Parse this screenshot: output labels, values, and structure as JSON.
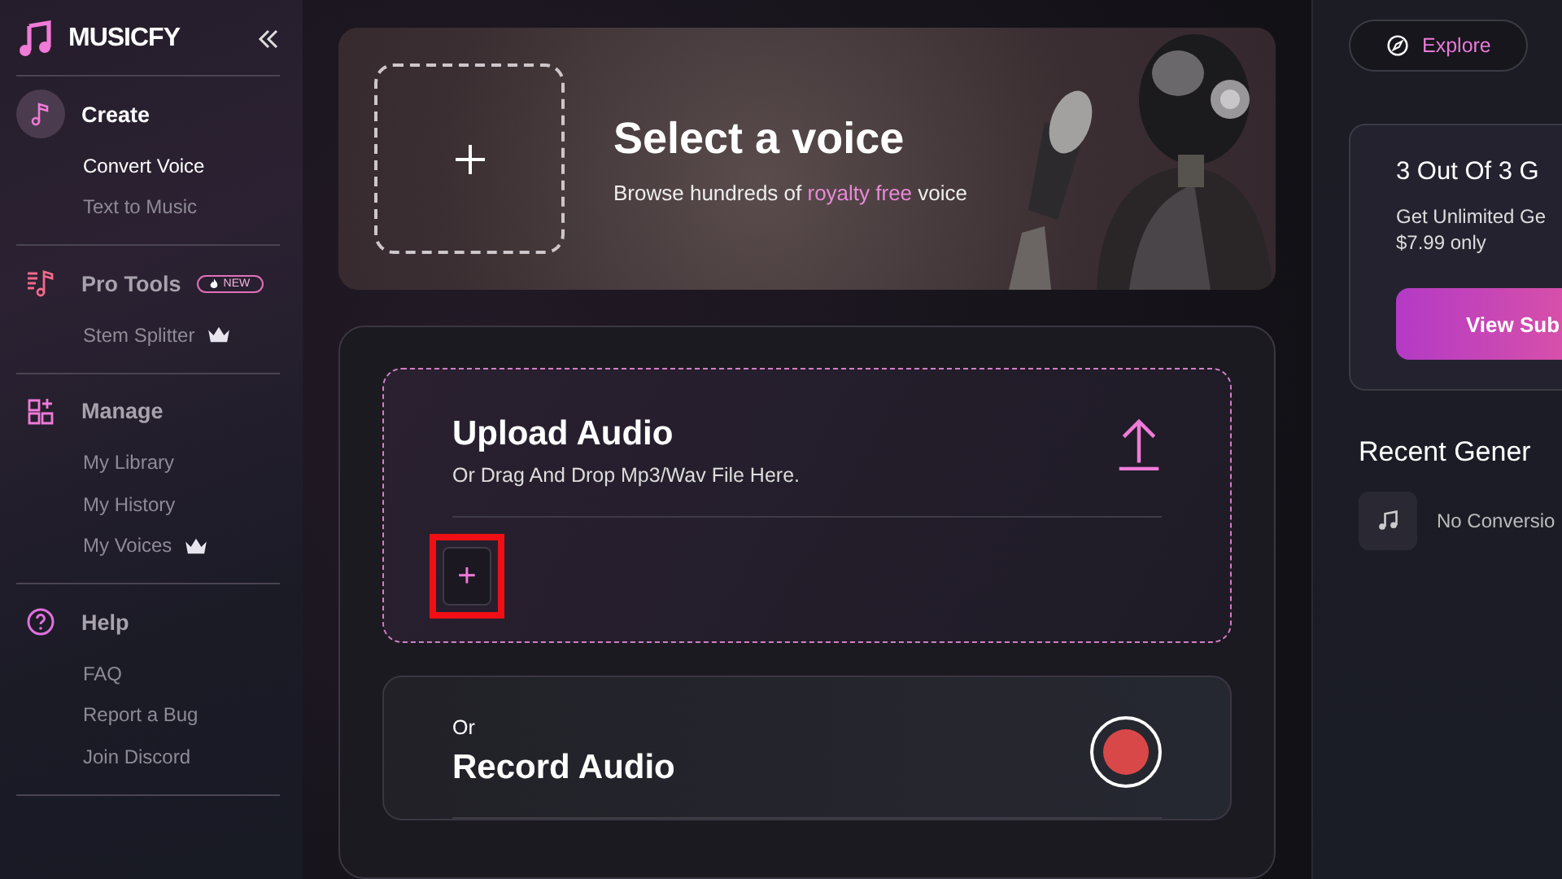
{
  "brand": {
    "name": "MUSICFY"
  },
  "sidebar": {
    "sections": [
      {
        "kind": "create",
        "title": "Create",
        "active": true,
        "items": [
          {
            "label": "Convert Voice",
            "selected": true,
            "premium": false
          },
          {
            "label": "Text to Music",
            "selected": false,
            "premium": false
          }
        ]
      },
      {
        "kind": "tools",
        "title": "Pro Tools",
        "active": false,
        "badge": "NEW",
        "items": [
          {
            "label": "Stem Splitter",
            "selected": false,
            "premium": true
          }
        ]
      },
      {
        "kind": "manage",
        "title": "Manage",
        "active": false,
        "items": [
          {
            "label": "My Library",
            "selected": false,
            "premium": false
          },
          {
            "label": "My History",
            "selected": false,
            "premium": false
          },
          {
            "label": "My Voices",
            "selected": false,
            "premium": true
          }
        ]
      },
      {
        "kind": "help",
        "title": "Help",
        "active": false,
        "items": [
          {
            "label": "FAQ",
            "selected": false,
            "premium": false
          },
          {
            "label": "Report a Bug",
            "selected": false,
            "premium": false
          },
          {
            "label": "Join Discord",
            "selected": false,
            "premium": false
          }
        ]
      }
    ]
  },
  "voice_banner": {
    "title": "Select a voice",
    "subtitle_before": "Browse hundreds of ",
    "subtitle_highlight": "royalty free",
    "subtitle_after": " voice"
  },
  "upload": {
    "title": "Upload Audio",
    "subtitle": "Or Drag And Drop Mp3/Wav File Here.",
    "add_button": {
      "symbol": "+",
      "highlighted": true
    }
  },
  "record": {
    "prefix": "Or",
    "title": "Record Audio"
  },
  "right_panel": {
    "explore": "Explore",
    "promo": {
      "title": "3 Out Of 3 G",
      "line_1": "Get Unlimited Ge",
      "line_2": "$7.99 only",
      "button": "View Sub"
    },
    "recent": {
      "title": "Recent Gener",
      "empty": "No Conversio"
    }
  }
}
